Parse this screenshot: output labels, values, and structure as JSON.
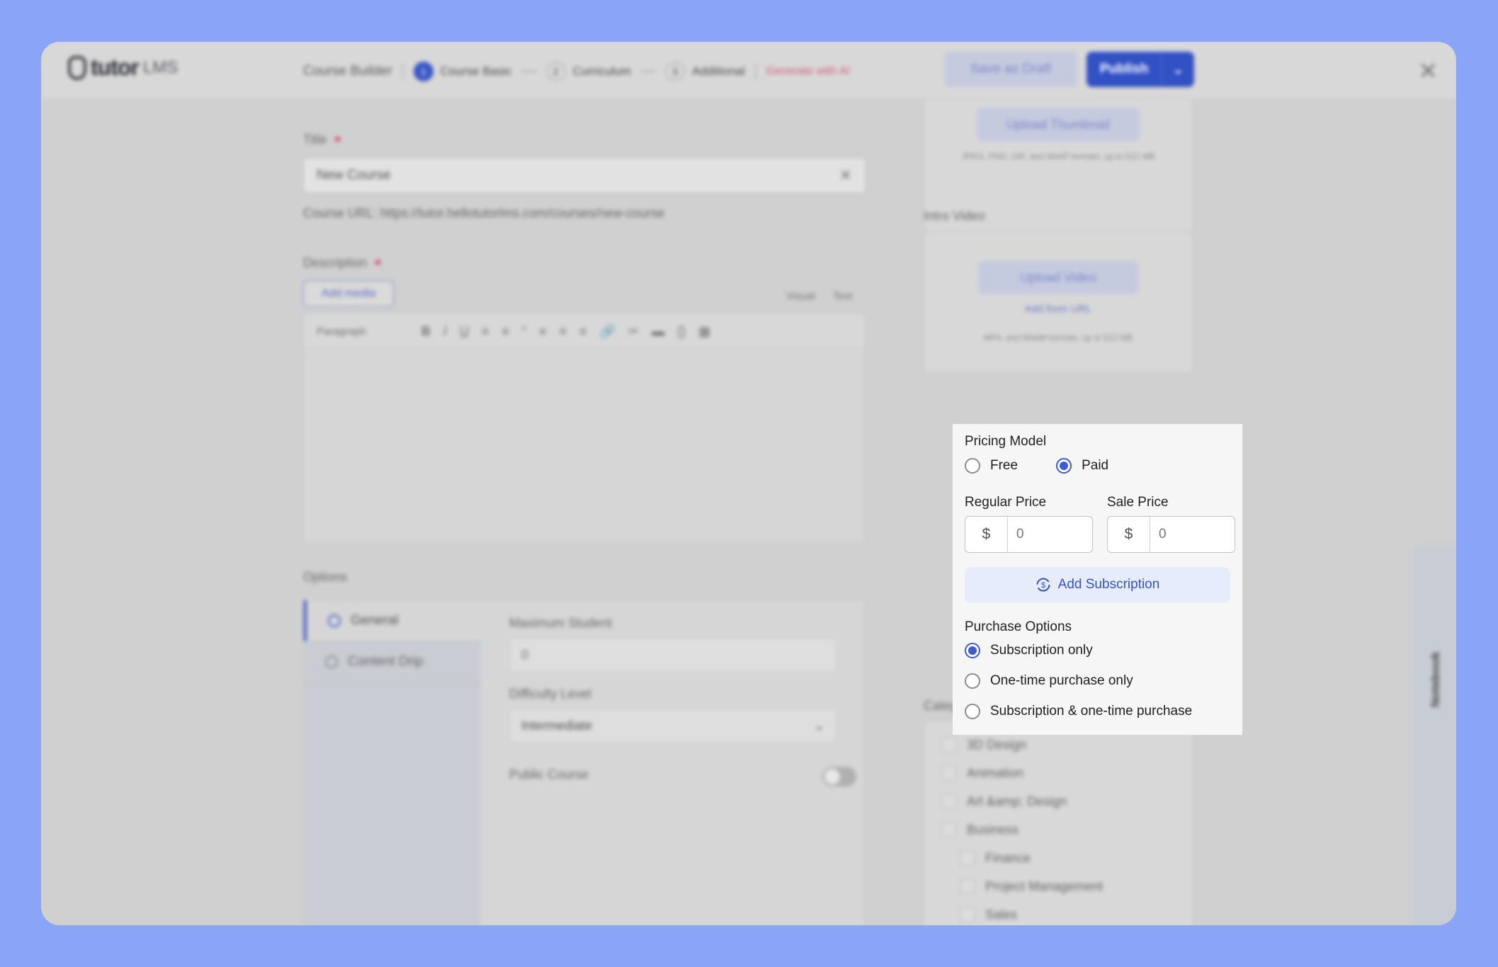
{
  "header": {
    "logo_text": "tutor",
    "logo_sub": "LMS",
    "builder_label": "Course Builder",
    "steps": [
      {
        "num": "1",
        "label": "Course Basic"
      },
      {
        "num": "2",
        "label": "Curriculum"
      },
      {
        "num": "3",
        "label": "Additional"
      }
    ],
    "generate_ai": "Generate with AI",
    "save_draft": "Save as Draft",
    "publish": "Publish"
  },
  "basics": {
    "title_label": "Title",
    "title_value": "New Course",
    "course_url": "Course URL: https://tutor.hellotutorlms.com/courses/new-course",
    "description_label": "Description",
    "add_media": "Add media",
    "tab_visual": "Visual",
    "tab_text": "Text",
    "paragraph_select": "Paragraph"
  },
  "options": {
    "label": "Options",
    "tabs": [
      "General",
      "Content Drip"
    ],
    "max_student_label": "Maximum Student",
    "max_student_value": "0",
    "difficulty_label": "Difficulty Level",
    "difficulty_value": "Intermediate",
    "public_course_label": "Public Course"
  },
  "media": {
    "upload_thumbnail": "Upload Thumbnail",
    "thumbnail_formats": "JPEG, PNG, GIF, and WebP formats, up to 512 MB",
    "intro_video_label": "Intro Video",
    "upload_video": "Upload Video",
    "add_from_url": "Add from URL",
    "video_formats": "MP4, and WebM formats, up to 512 MB"
  },
  "categories": {
    "label": "Categories",
    "items": [
      "3D Design",
      "Animation",
      "Art &amp; Design",
      "Business",
      "Finance",
      "Project Management",
      "Sales"
    ]
  },
  "notebook": "Notebook",
  "pricing": {
    "model_label": "Pricing Model",
    "model_options": [
      "Free",
      "Paid"
    ],
    "model_selected": "Paid",
    "regular_price_label": "Regular Price",
    "sale_price_label": "Sale Price",
    "currency": "$",
    "regular_price_value": "0",
    "sale_price_value": "0",
    "add_subscription": "Add Subscription",
    "purchase_label": "Purchase Options",
    "purchase_options": [
      "Subscription only",
      "One-time purchase only",
      "Subscription & one-time purchase"
    ],
    "purchase_selected": "Subscription only"
  },
  "colors": {
    "accent": "#3e5bd1",
    "background": "#8aa4f7"
  }
}
